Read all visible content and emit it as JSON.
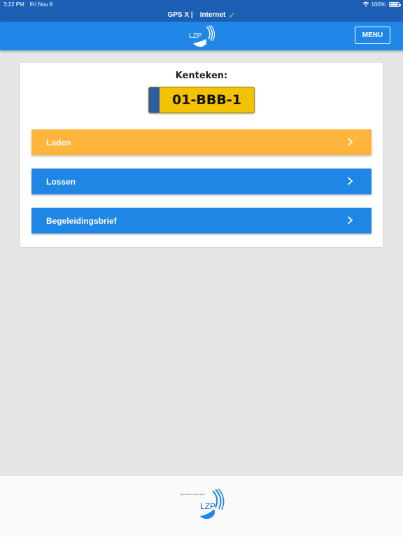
{
  "status": {
    "time": "3:22 PM",
    "date": "Fri Nov 8",
    "battery": "100%"
  },
  "gps": {
    "gps_label": "GPS X |",
    "internet_label": "Internet"
  },
  "header": {
    "logo_text": "LZP",
    "menu_label": "MENU"
  },
  "card": {
    "plate_label": "Kenteken:",
    "plate_number": "01-BBB-1",
    "actions": [
      {
        "label": "Laden",
        "color": "#ffb43b"
      },
      {
        "label": "Lossen",
        "color": "#1f86e6"
      },
      {
        "label": "Begeleidingsbrief",
        "color": "#1f86e6"
      }
    ]
  },
  "footer": {
    "logo_text": "LZP",
    "tagline": "hygienisch zorvuller pagoin"
  },
  "colors": {
    "brand": "#2087e8",
    "status_bar": "#1c5fb5",
    "plate": "#f3c200",
    "check": "#3dd17a"
  },
  "icons": [
    "wifi-icon",
    "battery-icon",
    "check-icon",
    "lzp-logo",
    "chevron-right-icon"
  ]
}
